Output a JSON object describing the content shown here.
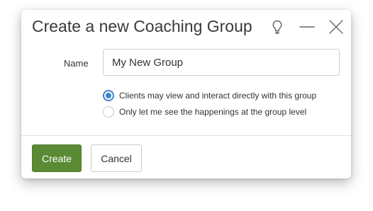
{
  "dialog": {
    "title": "Create a new Coaching Group",
    "icons": [
      "lightbulb-icon",
      "minimize-icon",
      "close-icon"
    ]
  },
  "form": {
    "name_label": "Name",
    "name_value": "My New Group",
    "visibility_options": [
      {
        "label": "Clients may view and interact directly with this group",
        "selected": true
      },
      {
        "label": "Only let me see the happenings at the group level",
        "selected": false
      }
    ]
  },
  "footer": {
    "create_label": "Create",
    "cancel_label": "Cancel"
  },
  "colors": {
    "primary_button": "#5a8a34",
    "radio_accent": "#3b83d1"
  }
}
